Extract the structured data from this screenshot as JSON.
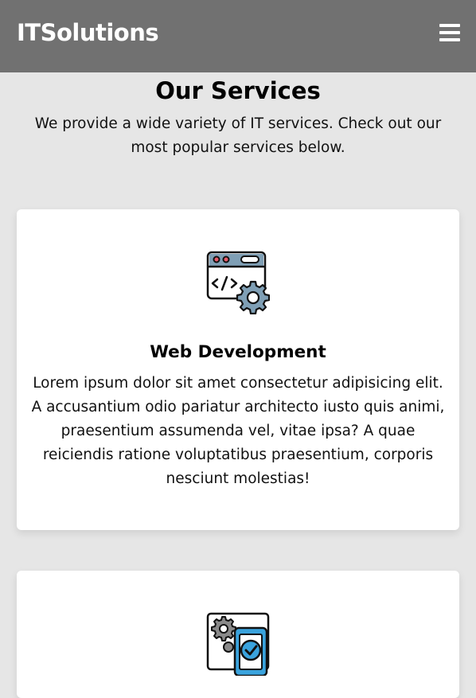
{
  "header": {
    "brand": "ITSolutions",
    "menu_icon": "hamburger-menu-icon"
  },
  "services_section": {
    "title": "Our Services",
    "intro": "We provide a wide variety of IT services. Check out our most popular services below."
  },
  "services": [
    {
      "icon": "web-development-icon",
      "title": "Web Development",
      "description": "Lorem ipsum dolor sit amet consectetur adipisicing elit. A accusantium odio pariatur architecto iusto quis animi, praesentium assumenda vel, vitae ipsa? A quae reiciendis ratione voluptatibus praesentium, corporis nesciunt molestias!"
    },
    {
      "icon": "app-development-icon"
    }
  ],
  "colors": {
    "header_bg": "#717171",
    "page_bg": "#e6e6e6",
    "card_bg": "#ffffff",
    "icon_accent": "#3aa3dd",
    "icon_gray": "#8a8a8a"
  }
}
